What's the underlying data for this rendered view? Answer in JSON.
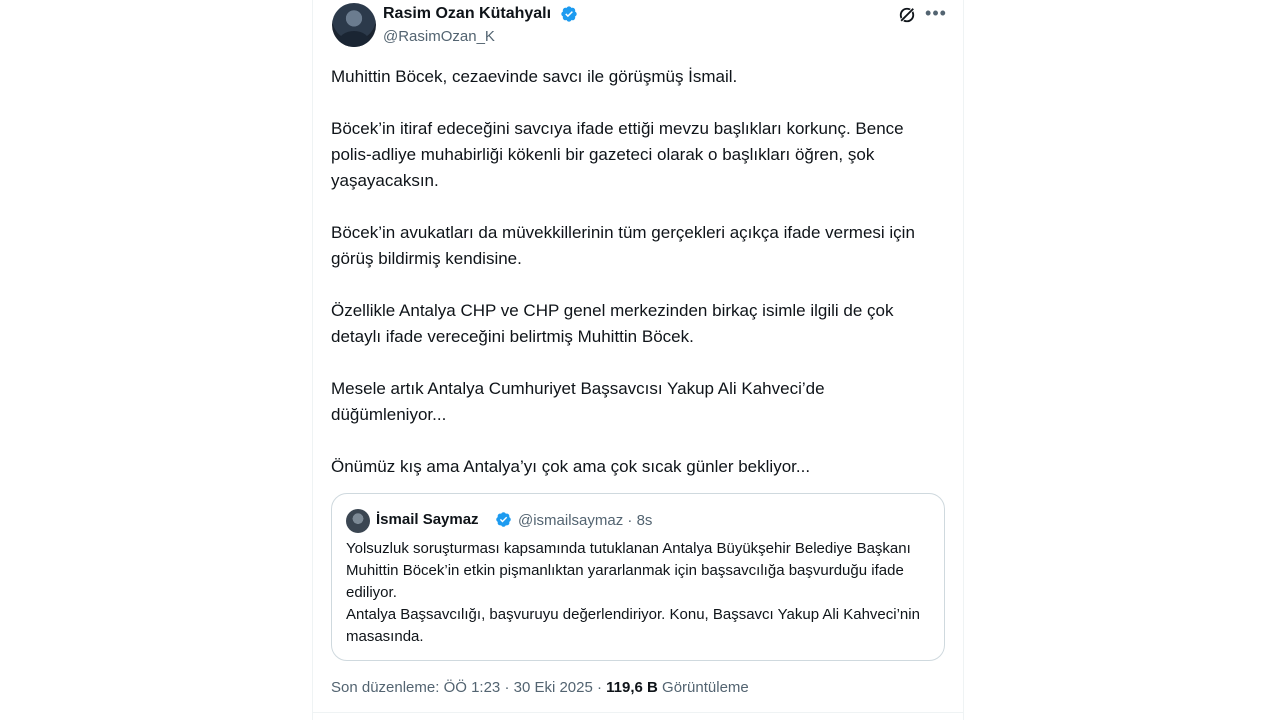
{
  "author": {
    "name": "Rasim Ozan Kütahyalı",
    "handle": "@RasimOzan_K",
    "verified": true
  },
  "tweet": {
    "paragraphs": [
      "Muhittin Böcek, cezaevinde savcı ile görüşmüş İsmail.",
      "Böcek’in itiraf edeceğini savcıya ifade ettiği mevzu başlıkları korkunç. Bence polis-adliye muhabirliği kökenli bir gazeteci olarak o başlıkları öğren, şok yaşayacaksın.",
      "Böcek’in avukatları da müvekkillerinin tüm gerçekleri açıkça ifade vermesi için görüş bildirmiş kendisine.",
      "Özellikle Antalya CHP ve CHP genel merkezinden birkaç isimle ilgili de çok detaylı ifade vereceğini belirtmiş Muhittin Böcek.",
      "Mesele artık Antalya Cumhuriyet Başsavcısı Yakup Ali Kahveci’de düğümleniyor...",
      "Önümüz kış ama Antalya’yı çok ama çok sıcak günler bekliyor..."
    ]
  },
  "quoted_tweet": {
    "name": "İsmail Saymaz",
    "handle": "@ismailsaymaz · 8s",
    "verified": true,
    "paragraphs": [
      "Yolsuzluk soruşturması kapsamında tutuklanan Antalya Büyükşehir Belediye Başkanı Muhittin Böcek’in etkin pişmanlıktan yararlanmak için başsavcılığa başvurduğu ifade ediliyor.",
      "Antalya Başsavcılığı, başvuruyu değerlendiriyor. Konu, Başsavcı Yakup Ali Kahveci’nin masasında."
    ]
  },
  "meta": {
    "edited": "Son düzenleme: ÖÖ 1:23 · 30 Eki 2025 · ",
    "views_count": "119,6 B",
    "views_label": " Görüntüleme"
  },
  "colors": {
    "verified_blue": "#1d9bf0",
    "secondary_text": "#536471",
    "primary_text": "#0f1419"
  },
  "icons": [
    "grok-icon",
    "more-icon",
    "verified-badge-icon"
  ]
}
